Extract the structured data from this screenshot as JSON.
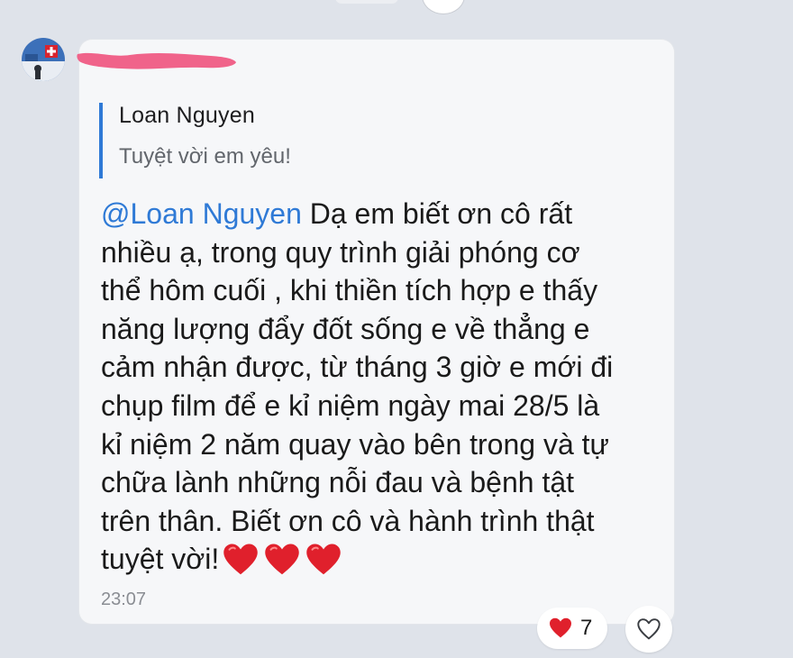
{
  "quote": {
    "author": "Loan Nguyen",
    "text": "Tuyệt vời em yêu!"
  },
  "message": {
    "mention": "@Loan Nguyen",
    "lines": [
      " Dạ em biết ơn cô rất",
      "nhiều ạ, trong quy trình giải phóng cơ",
      "thể hôm cuối , khi thiền tích hợp e thấy",
      "năng lượng đẩy đốt sống e về thẳng e",
      "cảm nhận được, từ tháng 3 giờ e mới đi",
      "chụp film để e kỉ niệm ngày mai 28/5 là",
      "kỉ niệm 2 năm quay vào bên trong và tự",
      "chữa lành những nỗi đau và bệnh tật",
      "trên thân. Biết ơn cô và hành trình thật",
      "tuyệt vời!"
    ],
    "emoji": [
      "red-heart-icon",
      "red-heart-icon",
      "red-heart-icon"
    ],
    "time": "23:07"
  },
  "reactions": {
    "icon": "red-heart-icon",
    "count": "7"
  },
  "like_button": {
    "icon": "heart-outline-icon"
  },
  "colors": {
    "mention": "#2f7ad6",
    "quote_bar": "#2f7ad6",
    "heart": "#e0202c",
    "background": "#dfe3ea",
    "bubble": "#f6f7f9"
  }
}
